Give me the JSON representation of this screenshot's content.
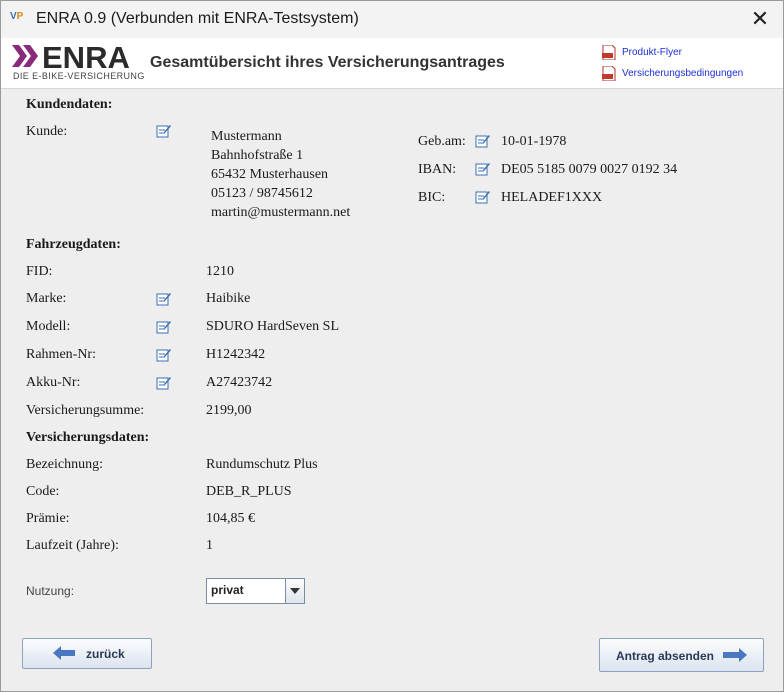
{
  "window": {
    "title": "ENRA 0.9 (Verbunden mit ENRA-Testsystem)",
    "icon_text": "V",
    "icon_text_accent": "P"
  },
  "header": {
    "logo_word": "ENRA",
    "logo_tagline": "DIE E-BIKE-VERSICHERUNG",
    "title": "Gesamtübersicht ihres Versicherungsantrages",
    "links": [
      "Produkt-Flyer",
      "Versicherungsbedingungen"
    ]
  },
  "kunde": {
    "section": "Kundendaten:",
    "label": "Kunde:",
    "name": "Mustermann",
    "street": "Bahnhofstraße 1",
    "city": "65432 Musterhausen",
    "phone": "05123 / 98745612",
    "email": "martin@mustermann.net",
    "geb_label": "Geb.am:",
    "geb_value": "10-01-1978",
    "iban_label": "IBAN:",
    "iban_value": "DE05 5185 0079 0027 0192 34",
    "bic_label": "BIC:",
    "bic_value": "HELADEF1XXX"
  },
  "fahrzeug": {
    "section": "Fahrzeugdaten:",
    "rows": [
      {
        "label": "FID:",
        "value": "1210"
      },
      {
        "label": "Marke:",
        "value": "Haibike"
      },
      {
        "label": "Modell:",
        "value": "SDURO HardSeven SL"
      },
      {
        "label": "Rahmen-Nr:",
        "value": "H1242342"
      },
      {
        "label": "Akku-Nr:",
        "value": "A27423742"
      },
      {
        "label": "Versicherungsumme:",
        "value": "2199,00"
      }
    ]
  },
  "versicherung": {
    "section": "Versicherungsdaten:",
    "rows": [
      {
        "label": "Bezeichnung:",
        "value": "Rundumschutz Plus"
      },
      {
        "label": "Code:",
        "value": "DEB_R_PLUS"
      },
      {
        "label": "Prämie:",
        "value": "104,85 €"
      },
      {
        "label": "Laufzeit (Jahre):",
        "value": "1"
      }
    ]
  },
  "nutzung": {
    "label": "Nutzung:",
    "value": "privat"
  },
  "buttons": {
    "back": "zurück",
    "submit": "Antrag absenden"
  },
  "colors": {
    "accent": "#8a2a7a",
    "link": "#1c2fd6",
    "arrow": "#4a78c0"
  }
}
